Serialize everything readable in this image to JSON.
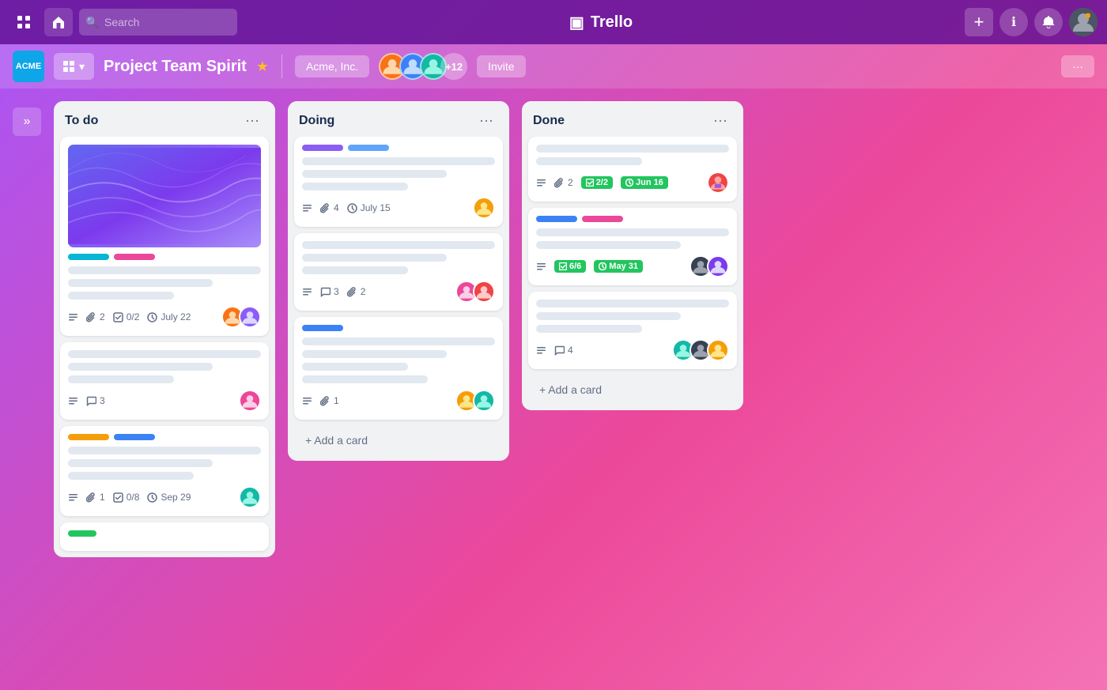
{
  "app": {
    "name": "Trello",
    "logo_symbol": "⊞"
  },
  "topnav": {
    "search_placeholder": "Search",
    "add_label": "+",
    "info_label": "ℹ",
    "bell_label": "🔔"
  },
  "board_header": {
    "workspace": "ACME",
    "view_btn_label": "⊞ ∨",
    "title": "Project Team Spirit",
    "workspace_badge": "Acme, Inc.",
    "more_count": "+12",
    "invite_label": "Invite",
    "more_label": "···"
  },
  "sidebar": {
    "toggle_label": "»"
  },
  "columns": [
    {
      "id": "todo",
      "title": "To do",
      "cards": [
        {
          "id": "card-todo-1",
          "has_cover": true,
          "tags": [
            "cyan",
            "pink"
          ],
          "lines": [
            "full",
            "3q",
            "half"
          ],
          "meta": {
            "description": true,
            "attachments": "2",
            "checklist": "0/2",
            "due": "July 22"
          },
          "avatars": [
            "orange",
            "purple"
          ]
        },
        {
          "id": "card-todo-2",
          "has_cover": false,
          "tags": [],
          "lines": [
            "full",
            "3q",
            "half"
          ],
          "meta": {
            "description": true,
            "comments": "3"
          },
          "avatars": [
            "pink"
          ]
        },
        {
          "id": "card-todo-3",
          "has_cover": false,
          "tags": [
            "yellow",
            "blue"
          ],
          "lines": [
            "full",
            "3q",
            "2q"
          ],
          "meta": {
            "description": true,
            "attachments": "1",
            "checklist": "0/8",
            "due": "Sep 29"
          },
          "avatars": [
            "teal"
          ]
        },
        {
          "id": "card-todo-4",
          "has_cover": false,
          "tags": [
            "green-sm"
          ],
          "lines": [],
          "meta": {},
          "avatars": []
        }
      ]
    },
    {
      "id": "doing",
      "title": "Doing",
      "cards": [
        {
          "id": "card-doing-1",
          "has_cover": false,
          "tags": [
            "purple",
            "blue-lt"
          ],
          "lines": [
            "full",
            "3q",
            "half"
          ],
          "meta": {
            "description": true,
            "attachments": "4",
            "due": "July 15"
          },
          "avatars": [
            "amber"
          ]
        },
        {
          "id": "card-doing-2",
          "has_cover": false,
          "tags": [],
          "lines": [
            "full",
            "3q",
            "half"
          ],
          "meta": {
            "description": true,
            "comments": "3",
            "attachments": "2"
          },
          "avatars": [
            "pink",
            "red"
          ]
        },
        {
          "id": "card-doing-3",
          "has_cover": false,
          "tags": [
            "blue"
          ],
          "lines": [
            "full",
            "3q",
            "half",
            "2q"
          ],
          "meta": {
            "description": true,
            "attachments": "1"
          },
          "avatars": [
            "amber",
            "teal"
          ]
        }
      ],
      "add_card_label": "+ Add a card"
    },
    {
      "id": "done",
      "title": "Done",
      "cards": [
        {
          "id": "card-done-1",
          "has_cover": false,
          "tags": [],
          "lines": [
            "full",
            "half"
          ],
          "meta": {
            "description": true,
            "attachments": "2",
            "checklist_done": "2/2",
            "due_done": "Jun 16"
          },
          "avatars": [
            "red-beard"
          ]
        },
        {
          "id": "card-done-2",
          "has_cover": false,
          "tags": [
            "blue",
            "pink"
          ],
          "lines": [
            "full",
            "3q"
          ],
          "meta": {
            "description": true,
            "checklist_done": "6/6",
            "due_done": "May 31"
          },
          "avatars": [
            "dark",
            "purple-av"
          ]
        },
        {
          "id": "card-done-3",
          "has_cover": false,
          "tags": [],
          "lines": [
            "full",
            "3q",
            "half"
          ],
          "meta": {
            "description": true,
            "comments": "4"
          },
          "avatars": [
            "teal",
            "dark2",
            "amber2"
          ]
        }
      ],
      "add_card_label": "+ Add a card"
    }
  ]
}
